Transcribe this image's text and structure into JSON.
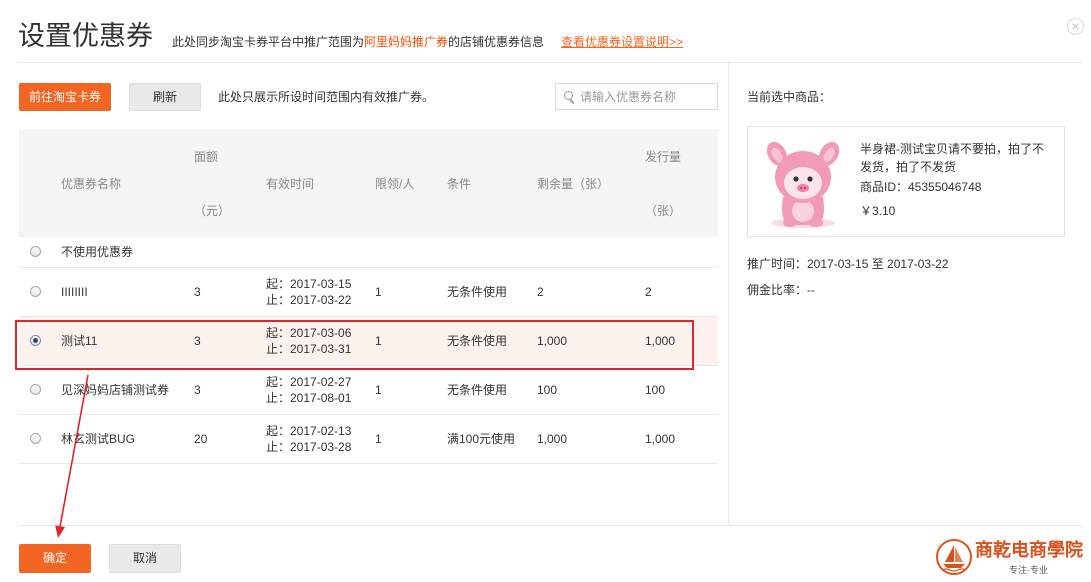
{
  "colors": {
    "accent": "#f26522",
    "highlight_text": "#ff4a00",
    "selected_row_bg": "#fdf2ee",
    "annotation_red": "#e0262b",
    "logo": "#d9531e"
  },
  "icons": {
    "close": "close-circle-icon",
    "search": "search-icon",
    "product_image": "pink-pig-product-image",
    "logo_emblem": "sailboat-emblem-icon",
    "annotation": "red-arrow-icon"
  },
  "header": {
    "title": "设置优惠券",
    "desc_prefix": "此处同步淘宝卡券平台中推广范围为",
    "desc_highlight": "阿里妈妈推广券",
    "desc_suffix": "的店铺优惠券信息",
    "help_link": "查看优惠券设置说明>>",
    "close_symbol": "×"
  },
  "toolbar": {
    "goto_button": "前往淘宝卡券",
    "refresh_button": "刷新",
    "note": "此处只展示所设时间范围内有效推广券。",
    "search": {
      "placeholder": "请输入优惠券名称",
      "value": ""
    }
  },
  "table": {
    "columns": {
      "name": "优惠券名称",
      "amount": "面额",
      "amount_unit": "（元）",
      "valid_time": "有效时间",
      "limit": "限领/人",
      "condition": "条件",
      "remaining": "剩余量（张）",
      "issued": "发行量",
      "issued_unit": "（张）"
    },
    "no_coupon": {
      "label": "不使用优惠券",
      "selected": false
    },
    "rows": [
      {
        "name": "IIIIIIII",
        "amount": "3",
        "valid_from": "起：2017-03-15",
        "valid_to": "止：2017-03-22",
        "limit": "1",
        "condition": "无条件使用",
        "remaining": "2",
        "issued": "2",
        "selected": false
      },
      {
        "name": "测试11",
        "amount": "3",
        "valid_from": "起：2017-03-06",
        "valid_to": "止：2017-03-31",
        "limit": "1",
        "condition": "无条件使用",
        "remaining": "1,000",
        "issued": "1,000",
        "selected": true
      },
      {
        "name": "见深妈妈店铺测试券",
        "amount": "3",
        "valid_from": "起：2017-02-27",
        "valid_to": "止：2017-08-01",
        "limit": "1",
        "condition": "无条件使用",
        "remaining": "100",
        "issued": "100",
        "selected": false
      },
      {
        "name": "林玄测试BUG",
        "amount": "20",
        "valid_from": "起：2017-02-13",
        "valid_to": "止：2017-03-28",
        "limit": "1",
        "condition": "满100元使用",
        "remaining": "1,000",
        "issued": "1,000",
        "selected": false
      }
    ]
  },
  "selected_product": {
    "heading": "当前选中商品：",
    "title": "半身裙-测试宝贝请不要拍，拍了不发货，拍了不发货",
    "id_text": "商品ID：45355046748",
    "price": "￥3.10",
    "promo_time": "推广时间：2017-03-15 至 2017-03-22",
    "commission": "佣金比率：--"
  },
  "footer": {
    "confirm_button": "确定",
    "cancel_button": "取消"
  },
  "logo": {
    "text": "商乾电商學院",
    "tagline": "专注·专业"
  }
}
